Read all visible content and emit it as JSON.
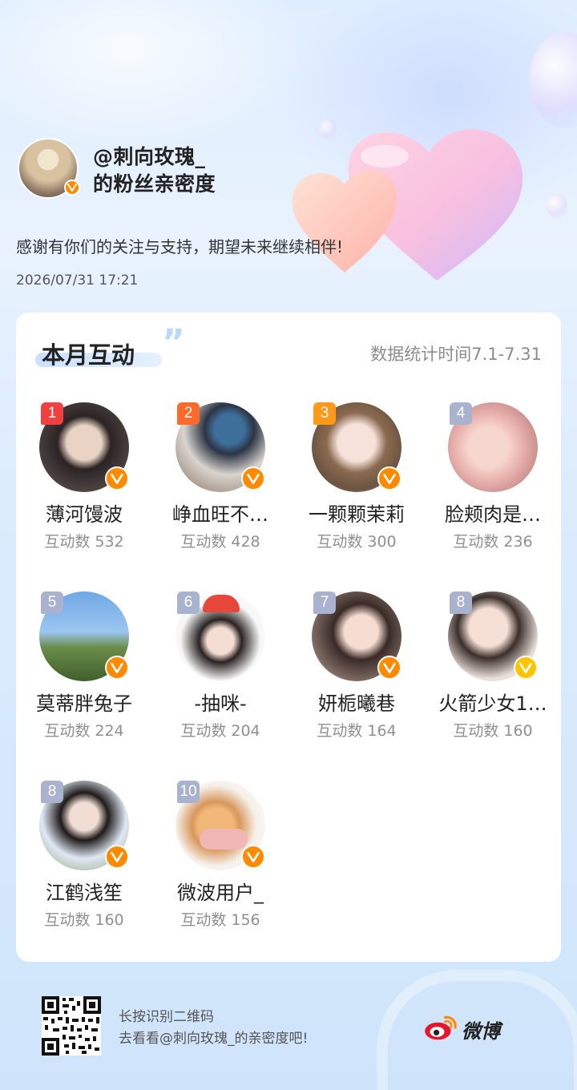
{
  "header": {
    "account_name": "@刺向玫瑰_",
    "subtitle": "的粉丝亲密度",
    "slogan": "感谢有你们的关注与支持，期望未来继续相伴!",
    "timestamp": "2026/07/31  17:21"
  },
  "card": {
    "title": "本月互动",
    "quote_mark": "”",
    "stat_range": "数据统计时间7.1-7.31",
    "fans": [
      {
        "rank": "1",
        "name": "薄河馒波",
        "count": "互动数 532",
        "badge": "orange"
      },
      {
        "rank": "2",
        "name": "峥血旺不…",
        "count": "互动数 428",
        "badge": "orange"
      },
      {
        "rank": "3",
        "name": "一颗颗茉莉",
        "count": "互动数 300",
        "badge": "orange"
      },
      {
        "rank": "4",
        "name": "脸颊肉是…",
        "count": "互动数 236",
        "badge": "none"
      },
      {
        "rank": "5",
        "name": "莫蒂胖兔子",
        "count": "互动数 224",
        "badge": "orange"
      },
      {
        "rank": "6",
        "name": "-抽咪-",
        "count": "互动数 204",
        "badge": "none"
      },
      {
        "rank": "7",
        "name": "妍栀曦巷",
        "count": "互动数 164",
        "badge": "orange"
      },
      {
        "rank": "8",
        "name": "火箭少女1…",
        "count": "互动数 160",
        "badge": "gold"
      },
      {
        "rank": "8",
        "name": "江鹤浅笙",
        "count": "互动数 160",
        "badge": "orange"
      },
      {
        "rank": "10",
        "name": "微波用户_",
        "count": "互动数 156",
        "badge": "orange"
      }
    ]
  },
  "footer": {
    "line1": "长按识别二维码",
    "line2": "去看看@刺向玫瑰_的亲密度吧!",
    "brand": "微博"
  },
  "colors": {
    "rank1": "#f04040",
    "rank2": "#ff6a2a",
    "rank3": "#ff9a18",
    "rank_other": "#a9b3cf",
    "badge_orange": "#ff8a00",
    "badge_gold": "#ffc400",
    "weibo_red": "#e6162d"
  },
  "icons": [
    "verified-badge-icon",
    "weibo-logo-icon",
    "qr-code-icon",
    "heart-decoration-icon"
  ]
}
